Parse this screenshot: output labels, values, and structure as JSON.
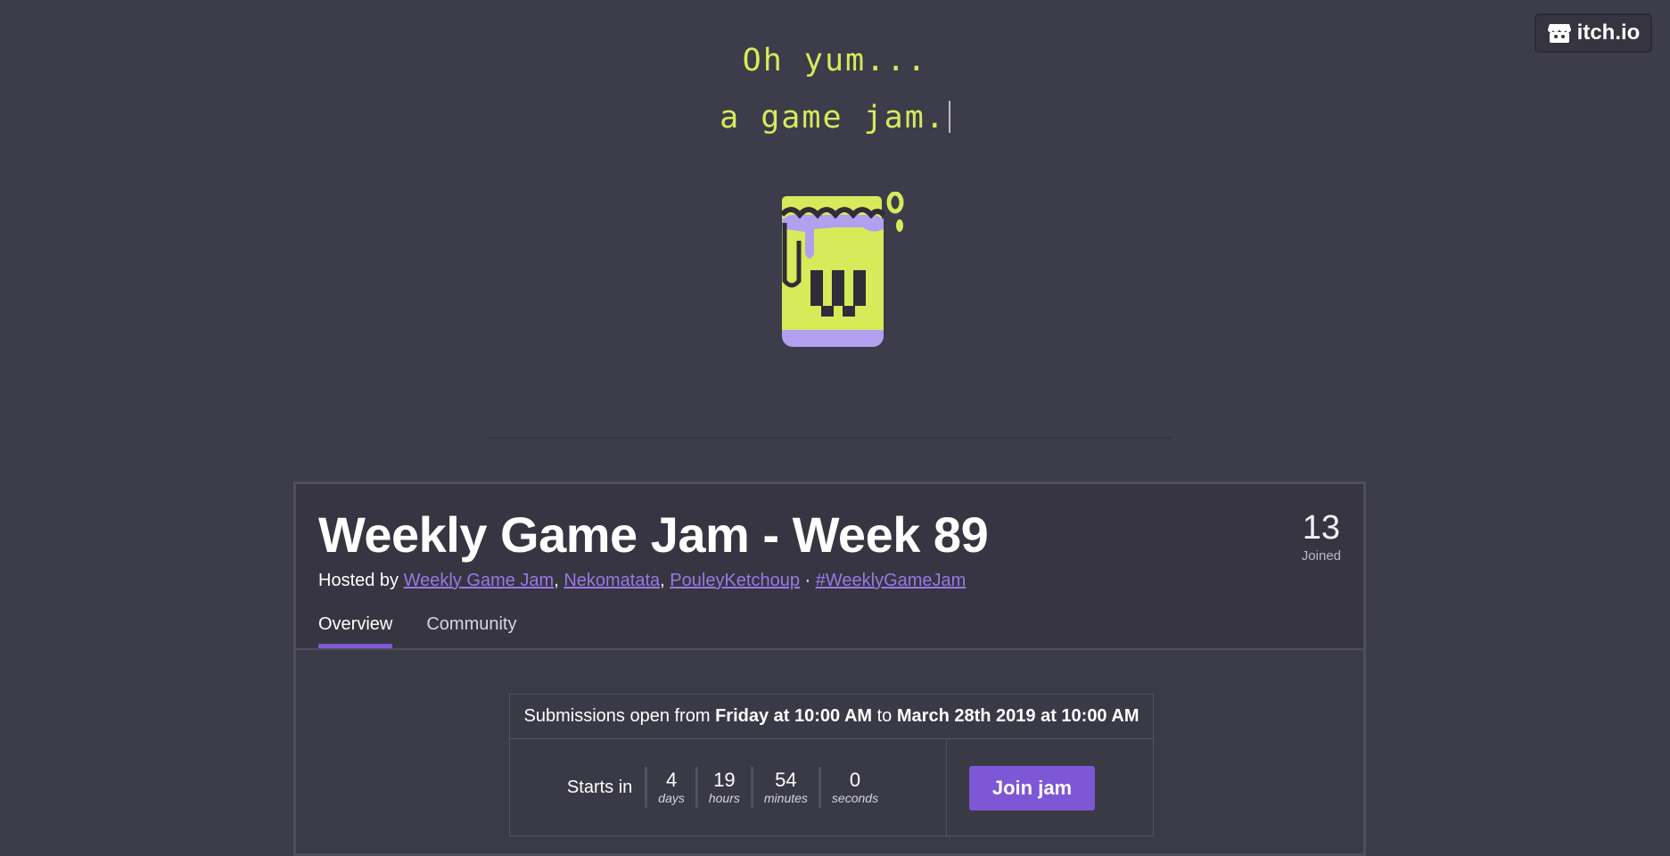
{
  "brand": {
    "name": "itch.io"
  },
  "hero": {
    "line1": "Oh yum...",
    "line2": "a game jam."
  },
  "jam": {
    "title": "Weekly Game Jam - Week 89",
    "hosted_prefix": "Hosted by",
    "hosts": [
      "Weekly Game Jam",
      "Nekomatata",
      "PouleyKetchoup"
    ],
    "hashtag": "#WeeklyGameJam",
    "joined_count": "13",
    "joined_label": "Joined"
  },
  "tabs": [
    {
      "label": "Overview",
      "active": true
    },
    {
      "label": "Community",
      "active": false
    }
  ],
  "schedule": {
    "prefix": "Submissions open from",
    "start": "Friday at 10:00 AM",
    "middle": "to",
    "end": "March 28th 2019 at 10:00 AM"
  },
  "countdown": {
    "label": "Starts in",
    "units": [
      {
        "value": "4",
        "label": "days"
      },
      {
        "value": "19",
        "label": "hours"
      },
      {
        "value": "54",
        "label": "minutes"
      },
      {
        "value": "0",
        "label": "seconds"
      }
    ]
  },
  "join_button": "Join jam",
  "colors": {
    "accent": "#7e57d6",
    "hero": "#d7ea5a",
    "background": "#3d3c4a",
    "link": "#9a78e6"
  }
}
